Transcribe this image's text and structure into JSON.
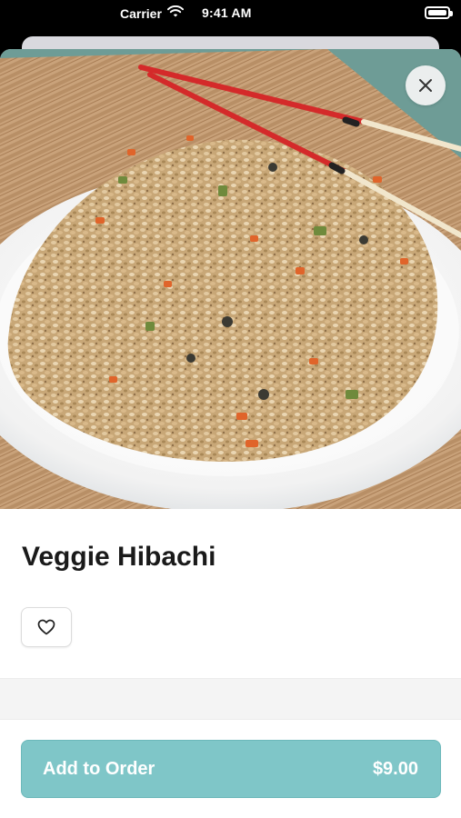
{
  "status_bar": {
    "carrier": "Carrier",
    "time": "9:41 AM",
    "wifi_icon": "wifi-icon",
    "battery_icon": "battery-icon"
  },
  "item": {
    "name": "Veggie Hibachi",
    "image_alt": "Plate of vegetable fried rice with chopsticks",
    "favorite_icon": "heart-icon"
  },
  "actions": {
    "close_icon": "close-icon",
    "add_to_order_label": "Add to Order",
    "price": "$9.00"
  },
  "colors": {
    "accent": "#7fc6c8",
    "accent_border": "#6cb8ba",
    "title": "#1a1a1a"
  }
}
